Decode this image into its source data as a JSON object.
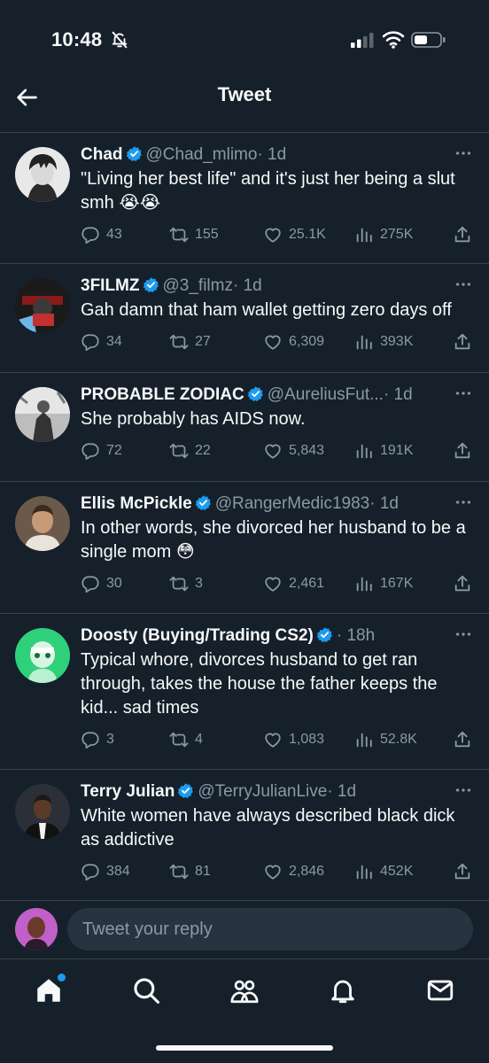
{
  "status": {
    "time": "10:48"
  },
  "header": {
    "title": "Tweet"
  },
  "tweets": [
    {
      "name": "Chad",
      "handle": "@Chad_mlimo",
      "time": "· 1d",
      "text": "\"Living her best life\" and it's just her being a slut smh 😭😭",
      "replies": "43",
      "retweets": "155",
      "likes": "25.1K",
      "views": "275K"
    },
    {
      "name": "3FILMZ",
      "handle": "@3_filmz",
      "time": "· 1d",
      "text": "Gah damn that ham wallet getting zero days off",
      "replies": "34",
      "retweets": "27",
      "likes": "6,309",
      "views": "393K"
    },
    {
      "name": "PROBABLE ZODIAC",
      "handle": "@AureliusFut...",
      "time": "· 1d",
      "text": "She probably has AIDS now.",
      "replies": "72",
      "retweets": "22",
      "likes": "5,843",
      "views": "191K"
    },
    {
      "name": "Ellis McPickle",
      "handle": "@RangerMedic1983",
      "time": "· 1d",
      "text": "In other words, she divorced her husband to be a single mom 😳",
      "replies": "30",
      "retweets": "3",
      "likes": "2,461",
      "views": "167K"
    },
    {
      "name": "Doosty (Buying/Trading CS2)",
      "handle": "",
      "time": "· 18h",
      "text": "Typical whore, divorces husband to get ran through, takes the house the father keeps the kid... sad times",
      "replies": "3",
      "retweets": "4",
      "likes": "1,083",
      "views": "52.8K"
    },
    {
      "name": "Terry Julian",
      "handle": "@TerryJulianLive",
      "time": "· 1d",
      "text": "White women have always described black dick as addictive",
      "replies": "384",
      "retweets": "81",
      "likes": "2,846",
      "views": "452K"
    }
  ],
  "reply": {
    "placeholder": "Tweet your reply"
  },
  "colors": {
    "background": "#15202b",
    "accent": "#1d9bf0",
    "muted": "#8b98a5",
    "divider": "#38444d"
  },
  "icons": [
    "back-arrow-icon",
    "verified-badge-icon",
    "more-icon",
    "reply-icon",
    "retweet-icon",
    "like-icon",
    "views-icon",
    "share-icon",
    "home-icon",
    "search-icon",
    "communities-icon",
    "notifications-icon",
    "messages-icon"
  ]
}
